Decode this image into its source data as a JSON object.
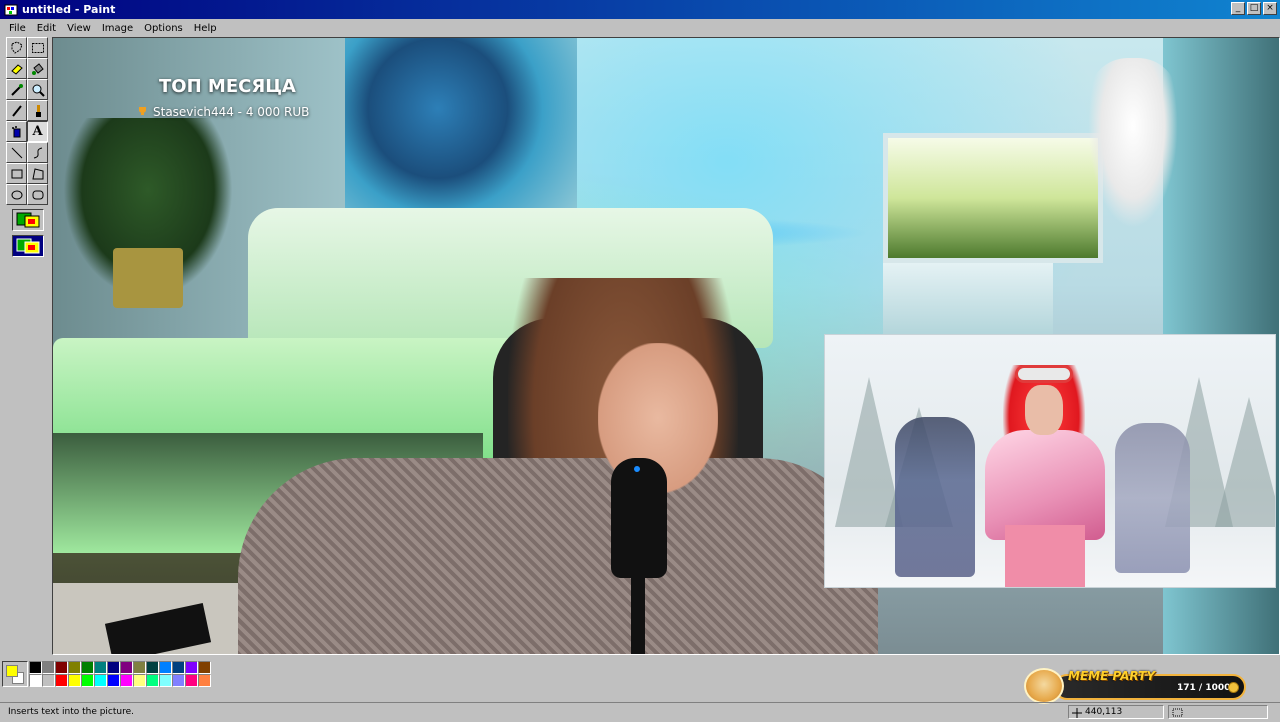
{
  "window": {
    "title": "untitled - Paint",
    "buttons": {
      "minimize": "_",
      "maximize": "□",
      "close": "×"
    }
  },
  "menu": [
    "File",
    "Edit",
    "View",
    "Image",
    "Options",
    "Help"
  ],
  "tools": [
    "free-form-select-icon",
    "select-icon",
    "eraser-icon",
    "fill-icon",
    "pick-color-icon",
    "magnifier-icon",
    "pencil-icon",
    "brush-icon",
    "airbrush-icon",
    "text-icon",
    "line-icon",
    "curve-icon",
    "rectangle-icon",
    "polygon-icon",
    "ellipse-icon",
    "rounded-rectangle-icon"
  ],
  "text_tool_glyph": "A",
  "stream_overlay": {
    "top_title": "ТОП МЕСЯЦА",
    "top_entry": "Stasevich444 - 4 000 RUB"
  },
  "palette": {
    "foreground": "#ffff00",
    "background": "#ffffff",
    "colors_row1": [
      "#000000",
      "#808080",
      "#800000",
      "#808000",
      "#008000",
      "#008080",
      "#000080",
      "#800080",
      "#808040",
      "#004040",
      "#0080ff",
      "#004080",
      "#8000ff",
      "#804000"
    ],
    "colors_row2": [
      "#ffffff",
      "#c0c0c0",
      "#ff0000",
      "#ffff00",
      "#00ff00",
      "#00ffff",
      "#0000ff",
      "#ff00ff",
      "#ffff80",
      "#00ff80",
      "#80ffff",
      "#8080ff",
      "#ff0080",
      "#ff8040"
    ]
  },
  "widget": {
    "title": "MEME PARTY",
    "count": "171 / 1000"
  },
  "status": {
    "help_text": "Inserts text into the picture.",
    "coords": "440,113"
  }
}
